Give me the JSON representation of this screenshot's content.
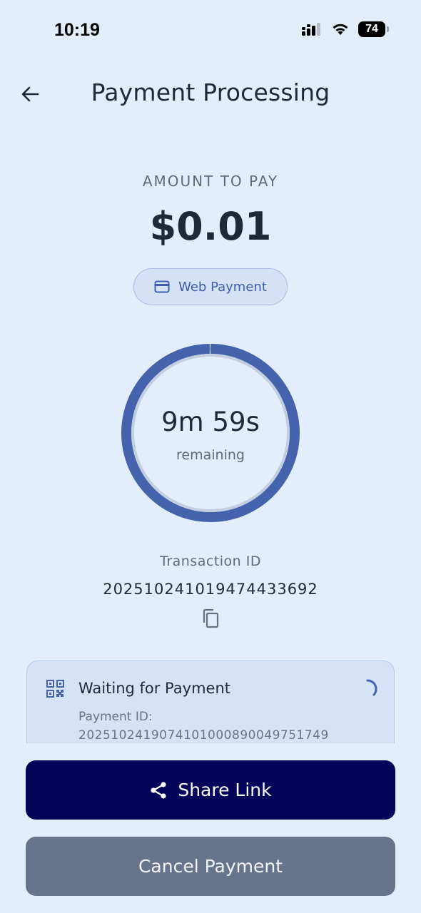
{
  "status_bar": {
    "time": "10:19",
    "battery": "74",
    "icons": [
      "signal-icon",
      "wifi-icon",
      "battery-icon"
    ]
  },
  "header": {
    "title": "Payment Processing",
    "back_icon": "back-arrow-icon"
  },
  "payment": {
    "amount_label": "AMOUNT TO PAY",
    "amount": "$0.01",
    "method": "Web Payment",
    "method_icon": "card-icon"
  },
  "timer": {
    "value": "9m 59s",
    "label": "remaining",
    "progress": 0.998
  },
  "transaction": {
    "label": "Transaction ID",
    "id": "20251024101947443369​2"
  },
  "status_card": {
    "title": "Waiting for Payment",
    "payment_id_label": "Payment ID:",
    "payment_id": "20251024190741010008900497517​49",
    "icon": "qr-code-icon"
  },
  "actions": {
    "share_label": "Share Link",
    "cancel_label": "Cancel Payment"
  },
  "colors": {
    "background": "#e2eefb",
    "accent": "#4563ad",
    "primary_button": "#04055a",
    "secondary_button": "#66758c"
  }
}
